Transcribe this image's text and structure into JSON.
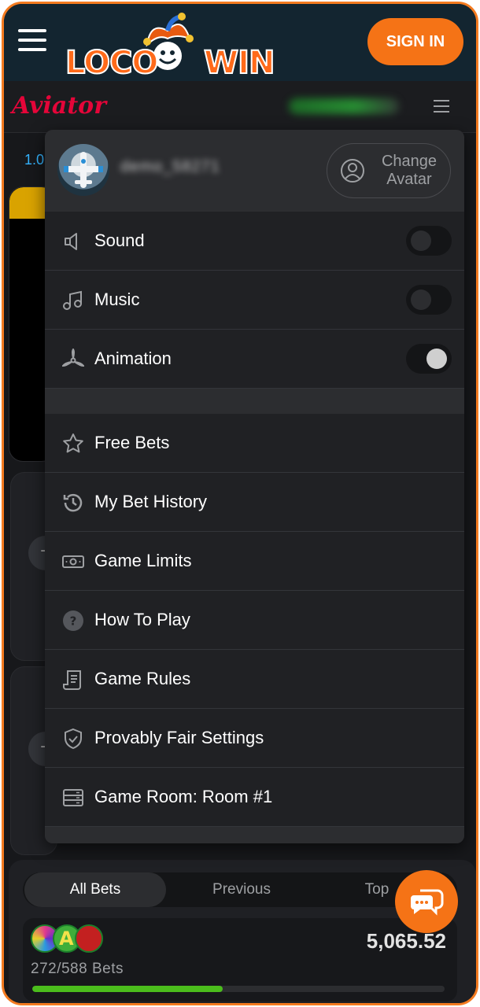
{
  "header": {
    "logo_left": "LOCO",
    "logo_right": "WIN",
    "sign_in_label": "SIGN IN"
  },
  "game_bar": {
    "title": "Aviator",
    "multiplier_first": "1.0"
  },
  "settings_menu": {
    "change_avatar_label": "Change Avatar",
    "toggles": [
      {
        "label": "Sound",
        "icon": "speaker-icon",
        "enabled": false
      },
      {
        "label": "Music",
        "icon": "music-note-icon",
        "enabled": false
      },
      {
        "label": "Animation",
        "icon": "propeller-icon",
        "enabled": true
      }
    ],
    "items": [
      {
        "label": "Free Bets",
        "icon": "star-icon"
      },
      {
        "label": "My Bet History",
        "icon": "history-icon"
      },
      {
        "label": "Game Limits",
        "icon": "banknote-icon"
      },
      {
        "label": "How To Play",
        "icon": "question-icon"
      },
      {
        "label": "Game Rules",
        "icon": "scroll-icon"
      },
      {
        "label": "Provably Fair Settings",
        "icon": "shield-check-icon"
      },
      {
        "label": "Game Room: Room #1",
        "icon": "server-icon"
      }
    ]
  },
  "bets": {
    "tabs": [
      "All Bets",
      "Previous",
      "Top"
    ],
    "active_tab": "All Bets",
    "count_label": "272/588 Bets",
    "total": "5,065.52",
    "progress_fraction": 0.4625
  },
  "colors": {
    "brand_orange": "#f57316",
    "aviator_red": "#e50539",
    "progress_green": "#4bbd1c"
  }
}
